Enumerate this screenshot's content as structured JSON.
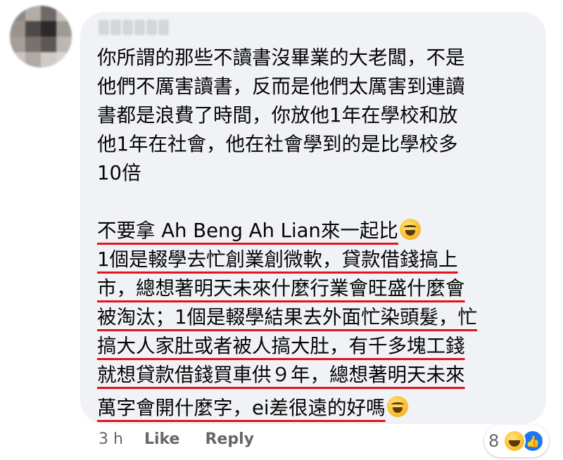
{
  "comment": {
    "paragraph1": [
      "你所謂的那些不讀書沒畢業的大老闆，不是",
      "他們不厲害讀書，反而是他們太厲害到連讀",
      "書都是浪費了時間，你放他1年在學校和放",
      "他1年在社會，他在社會學到的是比學校多",
      "10倍"
    ],
    "paragraph2": [
      "不要拿 Ah Beng Ah Lian來一起比",
      "1個是輟學去忙創業創微軟，貸款借錢搞上",
      "市，總想著明天未來什麼行業會旺盛什麼會",
      "被淘汰；1個是輟學結果去外面忙染頭髮，忙",
      "搞大人家肚或者被人搞大肚，有千多塊工錢",
      "就想貸款借錢買車供９年，總想著明天未來",
      "萬字會開什麼字，ei差很遠的好嗎"
    ],
    "emoji": "rolling-on-floor-laughing-icon"
  },
  "footer": {
    "time": "3 h",
    "like_label": "Like",
    "reply_label": "Reply"
  },
  "reactions": {
    "count": "8",
    "types": [
      "haha-reaction-icon",
      "like-reaction-icon"
    ]
  },
  "colors": {
    "bubble": "#f0f2f5",
    "underline": "#e0141e",
    "meta_text": "#65676b",
    "like_blue": "#1877f2"
  }
}
